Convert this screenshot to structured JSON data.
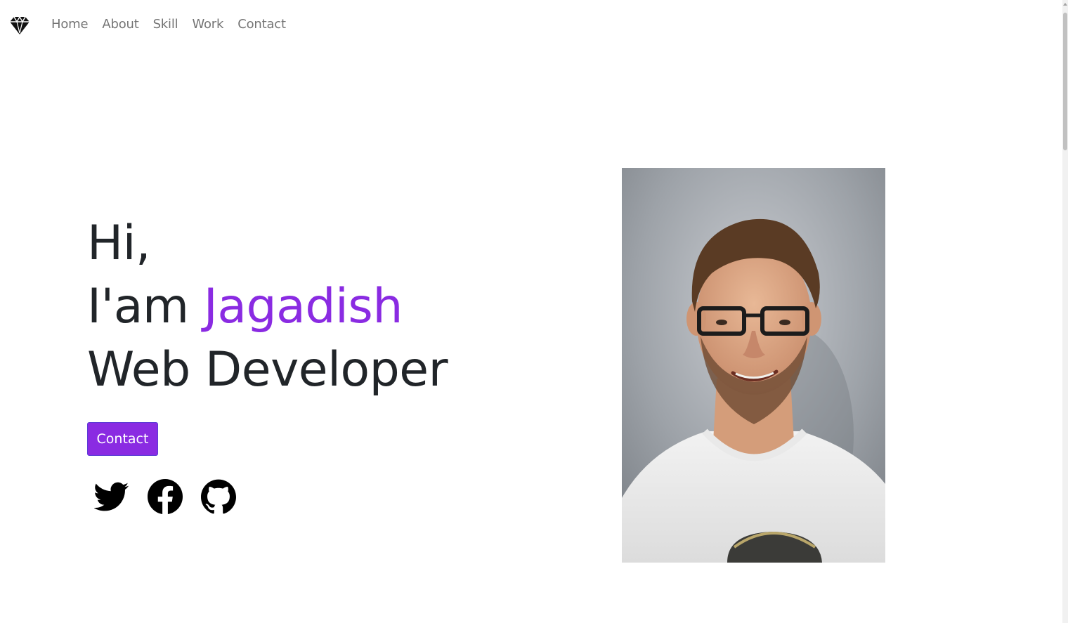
{
  "navbar": {
    "brand_icon": "diamond-icon",
    "links": [
      "Home",
      "About",
      "Skill",
      "Work",
      "Contact"
    ]
  },
  "hero": {
    "line1": "Hi,",
    "line2_prefix": "I'am ",
    "name": "Jagadish",
    "line3": "Web Developer",
    "contact_button": "Contact"
  },
  "socials": [
    "twitter-icon",
    "facebook-icon",
    "github-icon"
  ],
  "colors": {
    "accent": "#8a2be2",
    "text": "#212529",
    "nav_text": "#737373"
  },
  "portrait": {
    "subject": "smiling man with glasses in white t-shirt"
  }
}
